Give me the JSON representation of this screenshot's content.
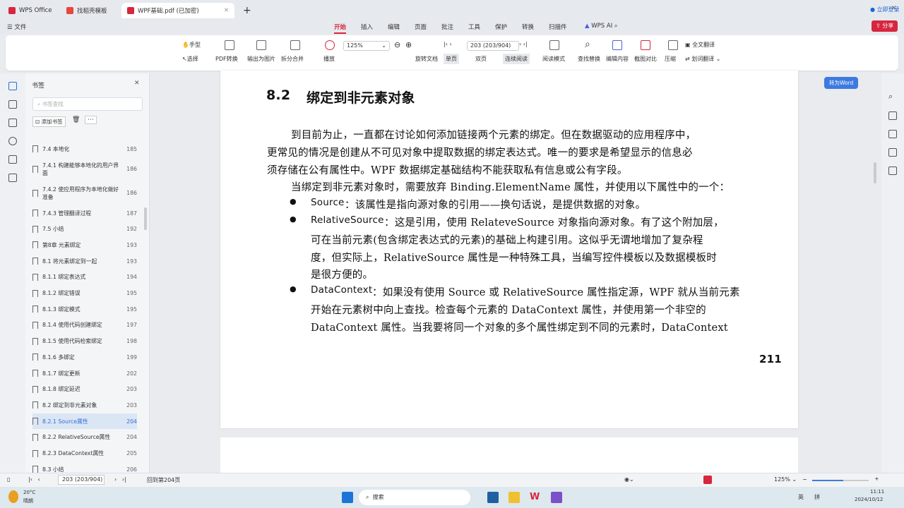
{
  "tabs": [
    {
      "label": "WPS Office",
      "color": "#d7263d"
    },
    {
      "label": "找稻壳模板",
      "color": "#e8453c"
    },
    {
      "label": "WPF基础.pdf (已加密)",
      "color": "#d7263d"
    }
  ],
  "login": "立即登录",
  "quick": {
    "file": "文件"
  },
  "menus": [
    "开始",
    "插入",
    "编辑",
    "页面",
    "批注",
    "工具",
    "保护",
    "转换",
    "扫描件"
  ],
  "wps_ai": "WPS AI",
  "share": "分享",
  "toolbar": {
    "hand": "手型",
    "select": "选择",
    "pdf_convert": "PDF转换",
    "export_image": "输出为图片",
    "split_merge": "拆分合并",
    "play": "播放",
    "zoom": "125%",
    "page": "203 (203/904)",
    "rotate": "旋转文档",
    "single": "单页",
    "double": "双页",
    "continuous": "连续阅读",
    "read_mode": "阅读模式",
    "find_replace": "查找替换",
    "edit_content": "编辑内容",
    "compare": "截图对比",
    "compress": "压缩",
    "full_translate": "全文翻译",
    "word_translate": "划词翻译"
  },
  "sidebar": {
    "title": "书签",
    "search_placeholder": "书签查找",
    "add_bookmark": "添加书签",
    "items": [
      {
        "label": "7.4 本地化",
        "page": "185"
      },
      {
        "label": "7.4.1 构建能够本地化的用户界面",
        "page": "186"
      },
      {
        "label": "7.4.2 使应用程序为本地化做好准备",
        "page": "186"
      },
      {
        "label": "7.4.3 管理翻译过程",
        "page": "187"
      },
      {
        "label": "7.5 小结",
        "page": "192"
      },
      {
        "label": "第8章 元素绑定",
        "page": "193"
      },
      {
        "label": "8.1 将元素绑定到一起",
        "page": "193"
      },
      {
        "label": "8.1.1 绑定表达式",
        "page": "194"
      },
      {
        "label": "8.1.2 绑定错误",
        "page": "195"
      },
      {
        "label": "8.1.3 绑定模式",
        "page": "195"
      },
      {
        "label": "8.1.4 使用代码创建绑定",
        "page": "197"
      },
      {
        "label": "8.1.5 使用代码检索绑定",
        "page": "198"
      },
      {
        "label": "8.1.6 多绑定",
        "page": "199"
      },
      {
        "label": "8.1.7 绑定更新",
        "page": "202"
      },
      {
        "label": "8.1.8 绑定延迟",
        "page": "203"
      },
      {
        "label": "8.2 绑定到非元素对象",
        "page": "203"
      },
      {
        "label": "8.2.1 Source属性",
        "page": "204",
        "selected": true
      },
      {
        "label": "8.2.2 RelativeSource属性",
        "page": "204"
      },
      {
        "label": "8.2.3 DataContext属性",
        "page": "205"
      },
      {
        "label": "8.3 小结",
        "page": "206"
      }
    ]
  },
  "to_word": "转为Word",
  "document": {
    "heading_num": "8.2",
    "heading": "绑定到非元素对象",
    "lines": [
      "到目前为止，一直都在讨论如何添加链接两个元素的绑定。但在数据驱动的应用程序中，",
      "更常见的情况是创建从不可见对象中提取数据的绑定表达式。唯一的要求是希望显示的信息必",
      "须存储在公有属性中。WPF 数据绑定基础结构不能获取私有信息或公有字段。",
      "当绑定到非元素对象时，需要放弃 Binding.ElementName 属性，并使用以下属性中的一个："
    ],
    "bullets": [
      {
        "term": "Source",
        "lines": [
          "：该属性是指向源对象的引用——换句话说，是提供数据的对象。"
        ]
      },
      {
        "term": "RelativeSource",
        "lines": [
          "：这是引用，使用 RelateveSource 对象指向源对象。有了这个附加层，",
          "可在当前元素(包含绑定表达式的元素)的基础上构建引用。这似乎无谓地增加了复杂程",
          "度，但实际上，RelativeSource 属性是一种特殊工具，当编写控件模板以及数据模板时",
          "是很方便的。"
        ]
      },
      {
        "term": "DataContext",
        "lines": [
          "：如果没有使用 Source 或 RelativeSource 属性指定源，WPF 就从当前元素",
          "开始在元素树中向上查找。检查每个元素的 DataContext 属性，并使用第一个非空的",
          "DataContext 属性。当我要将同一个对象的多个属性绑定到不同的元素时，DataContext"
        ]
      }
    ],
    "page_number": "211"
  },
  "status": {
    "page": "203 (203/904)",
    "back": "回到第204页",
    "zoom": "125%"
  },
  "taskbar": {
    "temp": "20°C",
    "weather": "晴朗",
    "search": "搜索",
    "lang": "英",
    "ime": "拼",
    "time": "11:11",
    "date": "2024/10/12"
  }
}
